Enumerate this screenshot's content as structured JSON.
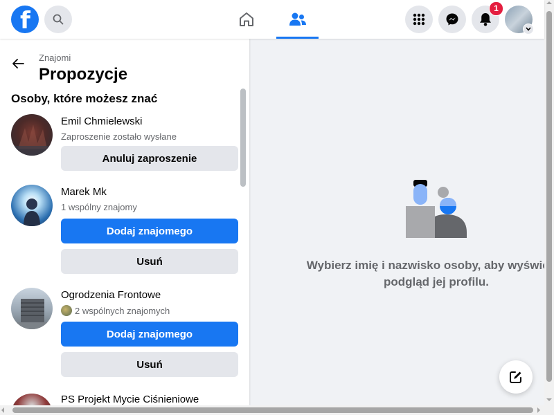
{
  "header": {
    "logo_letter": "f",
    "notifications_count": "1",
    "icons": [
      "facebook-logo",
      "search-icon",
      "home-icon",
      "friends-icon",
      "menu-grid-icon",
      "messenger-icon",
      "bell-icon",
      "account-avatar",
      "chevron-down-icon"
    ]
  },
  "sidebar": {
    "breadcrumb": "Znajomi",
    "title": "Propozycje",
    "section_title": "Osoby, które możesz znać",
    "people": [
      {
        "name": "Emil Chmielewski",
        "subtitle": "Zaproszenie zostało wysłane",
        "button": "Anuluj zaproszenie"
      },
      {
        "name": "Marek Mk",
        "subtitle": "1 wspólny znajomy",
        "add_button": "Dodaj znajomego",
        "remove_button": "Usuń"
      },
      {
        "name": "Ogrodzenia Frontowe",
        "subtitle": "2 wspólnych znajomych",
        "add_button": "Dodaj znajomego",
        "remove_button": "Usuń"
      },
      {
        "name": "PS Projekt Mycie Ciśnieniowe"
      }
    ]
  },
  "main": {
    "empty_text_line1": "Wybierz imię i nazwisko osoby, aby wyświetlić",
    "empty_text_line2": "podgląd jej profilu."
  },
  "colors": {
    "accent": "#1877f2",
    "badge": "#e41e3f",
    "background": "#f0f2f5"
  }
}
